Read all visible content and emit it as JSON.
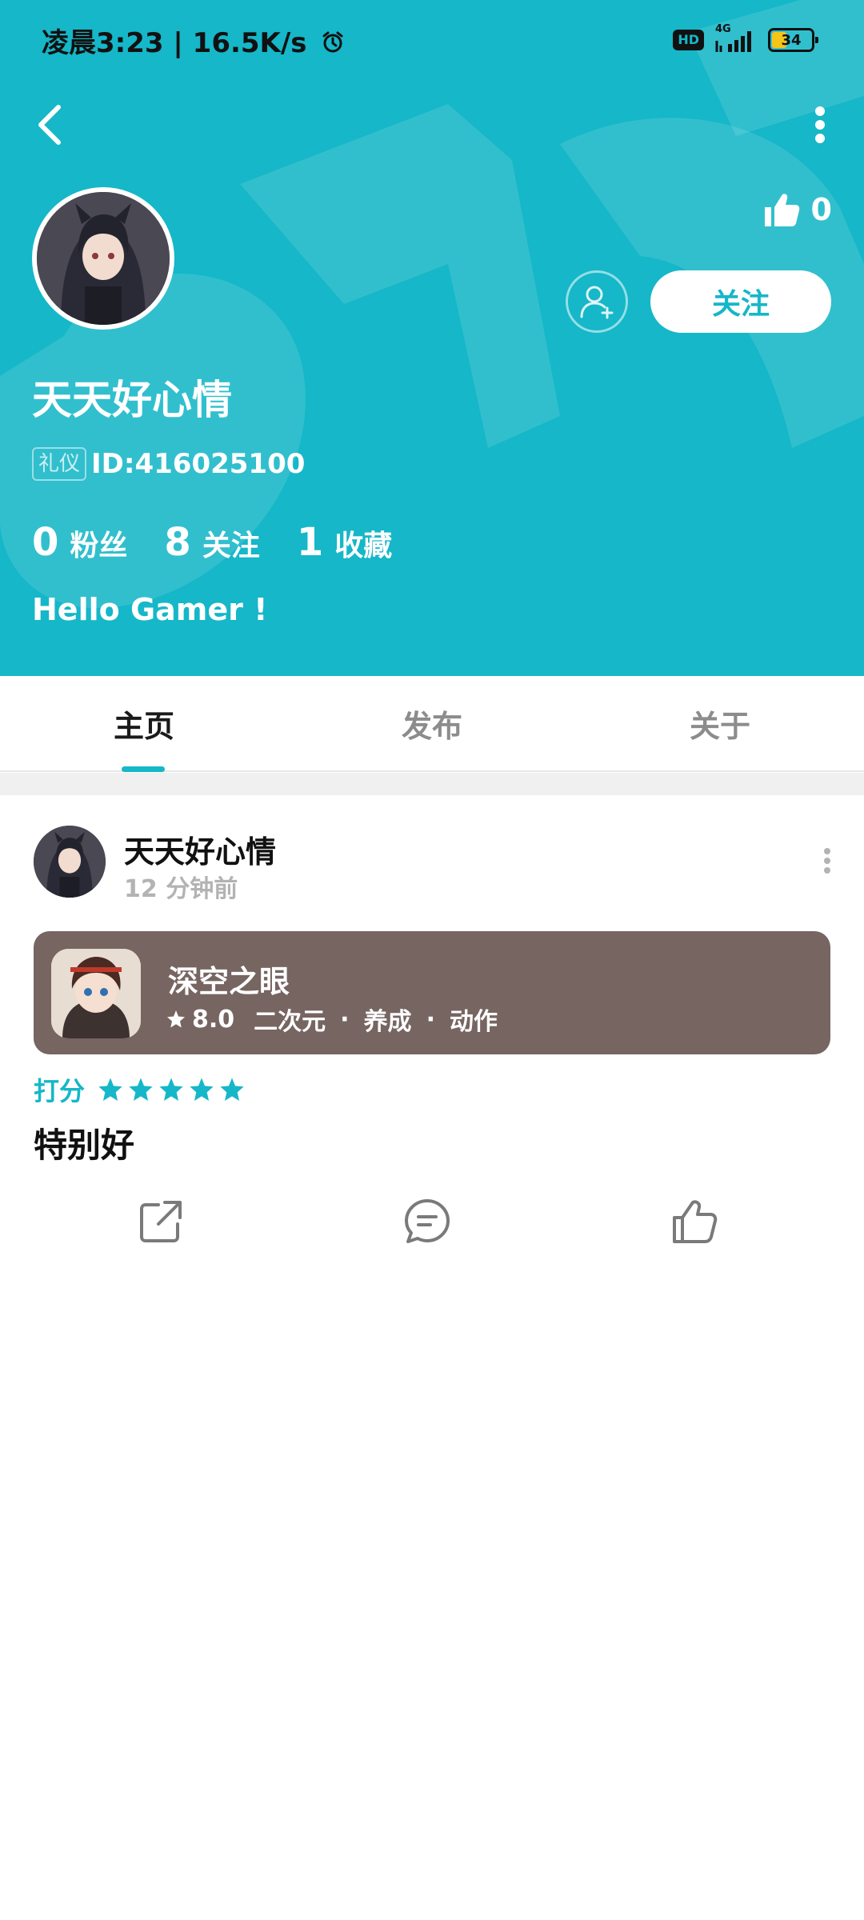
{
  "status_bar": {
    "time_speed": "凌晨3:23 | 16.5K/s",
    "hd_label": "HD",
    "network_label": "4G",
    "battery_level": "34"
  },
  "header": {
    "likes_count": "0",
    "follow_label": "关注",
    "username": "天天好心情",
    "level_badge": "礼仪",
    "user_id": "ID:416025100",
    "stats": [
      {
        "num": "0",
        "label": "粉丝"
      },
      {
        "num": "8",
        "label": "关注"
      },
      {
        "num": "1",
        "label": "收藏"
      }
    ],
    "bio": "Hello Gamer !"
  },
  "tabs": [
    {
      "label": "主页",
      "active": true
    },
    {
      "label": "发布",
      "active": false
    },
    {
      "label": "关于",
      "active": false
    }
  ],
  "post": {
    "author": "天天好心情",
    "time": "12 分钟前",
    "game": {
      "title": "深空之眼",
      "score": "8.0",
      "tags": [
        "二次元",
        "养成",
        "动作"
      ],
      "tag_separator": "·"
    },
    "rating_label": "打分",
    "rating_stars": 5,
    "review": "特别好"
  },
  "colors": {
    "accent": "#15b7c8",
    "game_card": "#766561"
  },
  "icons": [
    "back-arrow-icon",
    "more-vertical-icon",
    "thumbs-up-icon",
    "add-friend-icon",
    "star-icon",
    "share-icon",
    "comment-icon",
    "like-icon"
  ]
}
